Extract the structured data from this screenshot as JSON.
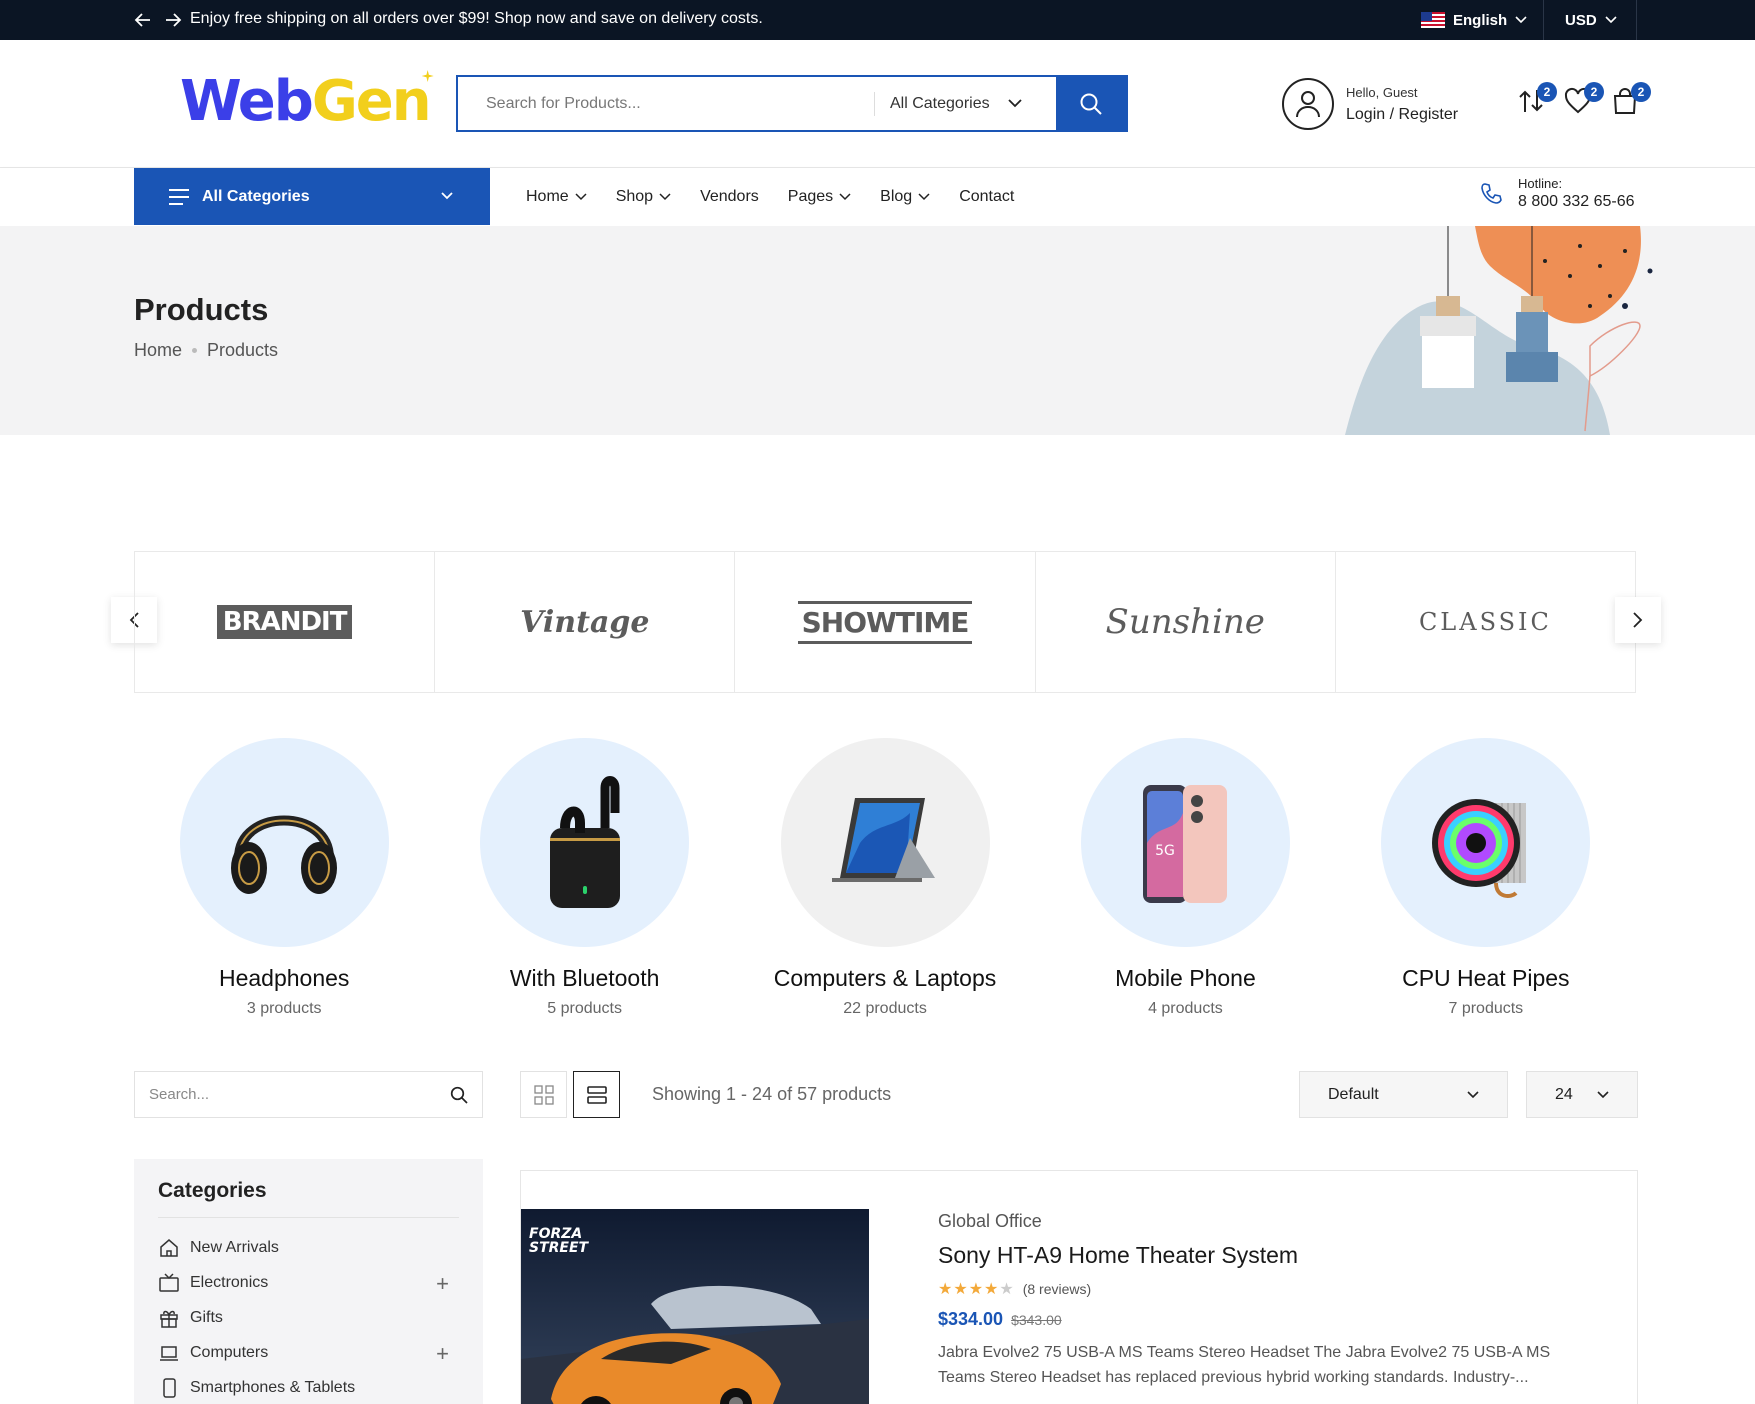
{
  "topbar": {
    "message": "Enjoy free shipping on all orders over $99! Shop now and save on delivery costs.",
    "language": "English",
    "currency": "USD"
  },
  "header": {
    "logo_part1": "Web",
    "logo_part2": "Gen",
    "search_placeholder": "Search for Products...",
    "category_select": "All Categories",
    "greeting": "Hello, Guest",
    "login_label": "Login / Register",
    "compare_count": "2",
    "wishlist_count": "2",
    "cart_count": "2"
  },
  "nav": {
    "all_categories": "All Categories",
    "items": [
      {
        "label": "Home",
        "dropdown": true
      },
      {
        "label": "Shop",
        "dropdown": true
      },
      {
        "label": "Vendors",
        "dropdown": false
      },
      {
        "label": "Pages",
        "dropdown": true
      },
      {
        "label": "Blog",
        "dropdown": true
      },
      {
        "label": "Contact",
        "dropdown": false
      }
    ],
    "hotline_label": "Hotline:",
    "hotline_number": "8 800 332 65-66"
  },
  "banner": {
    "title": "Products",
    "breadcrumb": [
      "Home",
      "Products"
    ]
  },
  "brands": [
    "BRANDIT",
    "Vintage",
    "SHOWTIME",
    "Sunshine",
    "CLASSIC"
  ],
  "categories": [
    {
      "name": "Headphones",
      "count": "3 products",
      "icon": "headphones-icon"
    },
    {
      "name": "With Bluetooth",
      "count": "5 products",
      "icon": "earbuds-icon"
    },
    {
      "name": "Computers & Laptops",
      "count": "22 products",
      "icon": "tablet-laptop-icon"
    },
    {
      "name": "Mobile Phone",
      "count": "4 products",
      "icon": "smartphone-icon"
    },
    {
      "name": "CPU Heat Pipes",
      "count": "7 products",
      "icon": "cpu-cooler-icon"
    }
  ],
  "toolbar": {
    "search_placeholder": "Search...",
    "showing": "Showing 1 - 24 of 57 products",
    "sort": "Default",
    "per_page": "24"
  },
  "sidebar": {
    "title": "Categories",
    "items": [
      {
        "label": "New Arrivals",
        "expandable": false,
        "icon": "home-icon"
      },
      {
        "label": "Electronics",
        "expandable": true,
        "icon": "tv-icon"
      },
      {
        "label": "Gifts",
        "expandable": false,
        "icon": "gift-icon"
      },
      {
        "label": "Computers",
        "expandable": true,
        "icon": "laptop-icon"
      },
      {
        "label": "Smartphones & Tablets",
        "expandable": false,
        "icon": "phone-icon"
      }
    ]
  },
  "product": {
    "vendor": "Global Office",
    "name": "Sony HT-A9 Home Theater System",
    "rating": 4,
    "reviews": "(8 reviews)",
    "price": "$334.00",
    "old_price": "$343.00",
    "image_caption": "FORZA STREET",
    "description": "Jabra Evolve2 75 USB-A MS Teams Stereo Headset The Jabra Evolve2 75 USB-A MS Teams Stereo Headset has replaced previous hybrid working standards. Industry-..."
  },
  "colors": {
    "accent": "#1a55b5",
    "topbar": "#0b1524",
    "circle_bg": "#e4f0fd"
  }
}
